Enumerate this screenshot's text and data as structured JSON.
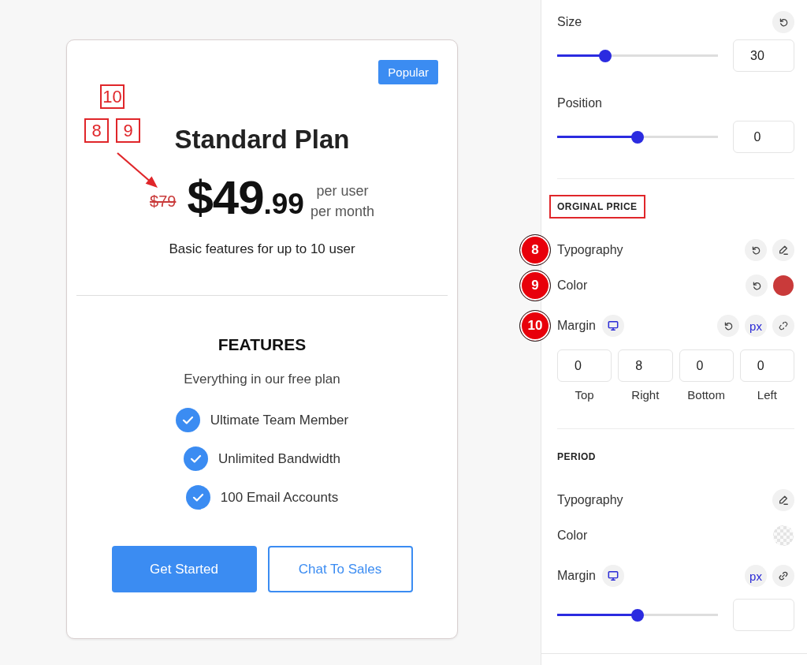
{
  "card": {
    "badge": "Popular",
    "title": "Standard Plan",
    "original_price": "$79",
    "price": "$49",
    "price_cents": ".99",
    "period": [
      "per user",
      "per month"
    ],
    "description": "Basic features for up to 10 user",
    "features_heading": "FEATURES",
    "features_subtitle": "Everything in our free plan",
    "features": [
      "Ultimate Team Member",
      "Unlimited Bandwidth",
      "100 Email Accounts"
    ],
    "buttons": [
      {
        "label": "Get Started",
        "kind": "primary"
      },
      {
        "label": "Chat To Sales",
        "kind": "outline"
      }
    ]
  },
  "card_callouts": [
    "10",
    "8",
    "9"
  ],
  "panel": {
    "sections": [
      {
        "rows": [
          {
            "kind": "slider",
            "label": "Size",
            "resettable": true,
            "level": 0.3,
            "value": "30"
          },
          {
            "kind": "slider",
            "label": "Position",
            "resettable": false,
            "level": 0.5,
            "value": "0"
          }
        ]
      },
      {
        "title": "ORGINAL PRICE",
        "highlighted": true,
        "rows": [
          {
            "kind": "typography",
            "label": "Typography",
            "resettable": true,
            "callout": "8"
          },
          {
            "kind": "color",
            "label": "Color",
            "resettable": true,
            "color": "#c93a3a",
            "callout": "9"
          },
          {
            "kind": "margin_sides",
            "label": "Margin",
            "resettable": true,
            "unit": "px",
            "linked": false,
            "callout": "10",
            "sides": [
              {
                "label": "Top",
                "value": "0"
              },
              {
                "label": "Right",
                "value": "8"
              },
              {
                "label": "Bottom",
                "value": "0"
              },
              {
                "label": "Left",
                "value": "0"
              }
            ]
          }
        ]
      },
      {
        "title": "PERIOD",
        "highlighted": false,
        "rows": [
          {
            "kind": "typography",
            "label": "Typography",
            "resettable": false
          },
          {
            "kind": "color",
            "label": "Color",
            "resettable": false
          },
          {
            "kind": "margin_slider",
            "label": "Margin",
            "resettable": false,
            "unit": "px",
            "linked": true,
            "level": 0.5
          }
        ]
      }
    ]
  }
}
